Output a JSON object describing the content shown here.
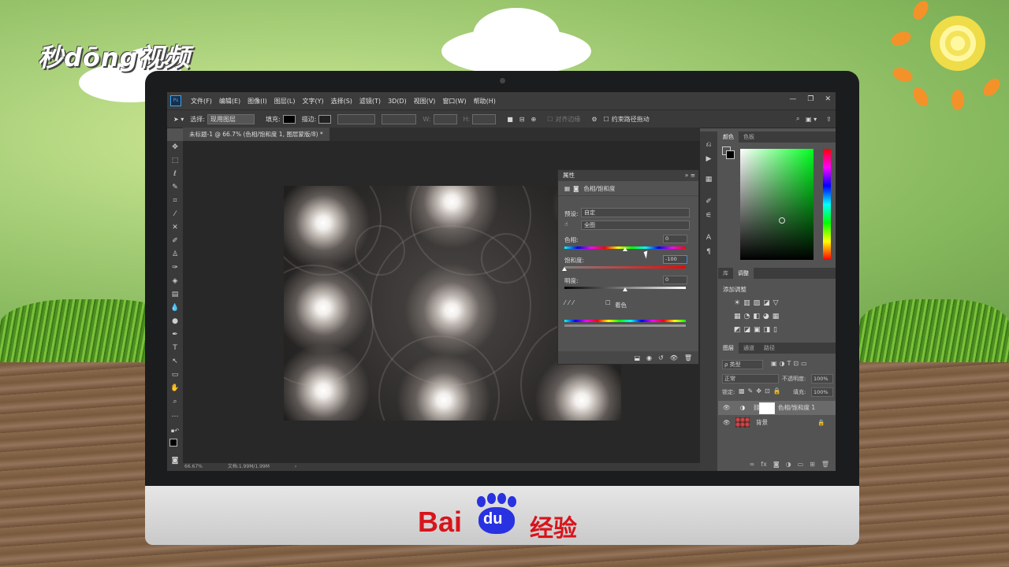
{
  "watermark": {
    "brand_logo": "秒dōng视频",
    "baidu_text": "Bai",
    "baidu_du": "du",
    "baidu_suffix": "经验"
  },
  "app": {
    "logo": "Ps",
    "menu": [
      "文件(F)",
      "编辑(E)",
      "图像(I)",
      "图层(L)",
      "文字(Y)",
      "选择(S)",
      "滤镜(T)",
      "3D(D)",
      "视图(V)",
      "窗口(W)",
      "帮助(H)"
    ],
    "window_controls": [
      "—",
      "❐",
      "✕"
    ]
  },
  "options_bar": {
    "select_label": "选择:",
    "select_value": "现用图层",
    "fill_label": "填充:",
    "stroke_label": "描边:",
    "w_label": "W:",
    "h_label": "H:",
    "align_edges": "对齐边缘",
    "constrain_path": "约束路径拖动"
  },
  "document": {
    "tab_title": "未标题-1 @ 66.7% (色相/饱和度 1, 图层蒙版/8) *",
    "zoom": "66.67%",
    "doc_info": "文档:1.99M/1.99M"
  },
  "properties": {
    "title": "属性",
    "subtitle": "色相/饱和度",
    "preset_label": "预设:",
    "preset_value": "自定",
    "channel_value": "全图",
    "hue_label": "色相:",
    "hue_value": "0",
    "hue_fraction": 0.5,
    "saturation_label": "饱和度:",
    "saturation_value": "-100",
    "saturation_fraction": 0.0,
    "lightness_label": "明度:",
    "lightness_value": "0",
    "lightness_fraction": 0.5,
    "colorize_label": "着色"
  },
  "color_panel": {
    "tabs": [
      "颜色",
      "色板"
    ]
  },
  "adjustments_panel": {
    "tabs": [
      "库",
      "调整"
    ],
    "add_label": "添加调整"
  },
  "layers_panel": {
    "tabs": [
      "图层",
      "通道",
      "路径"
    ],
    "kind_filter": "ρ 类型",
    "blend_mode": "正常",
    "opacity_label": "不透明度:",
    "opacity_value": "100%",
    "lock_label": "锁定:",
    "fill_label": "填充:",
    "fill_value": "100%",
    "layers": [
      {
        "name": "色相/饱和度 1",
        "selected": true
      },
      {
        "name": "背景",
        "selected": false
      }
    ]
  }
}
